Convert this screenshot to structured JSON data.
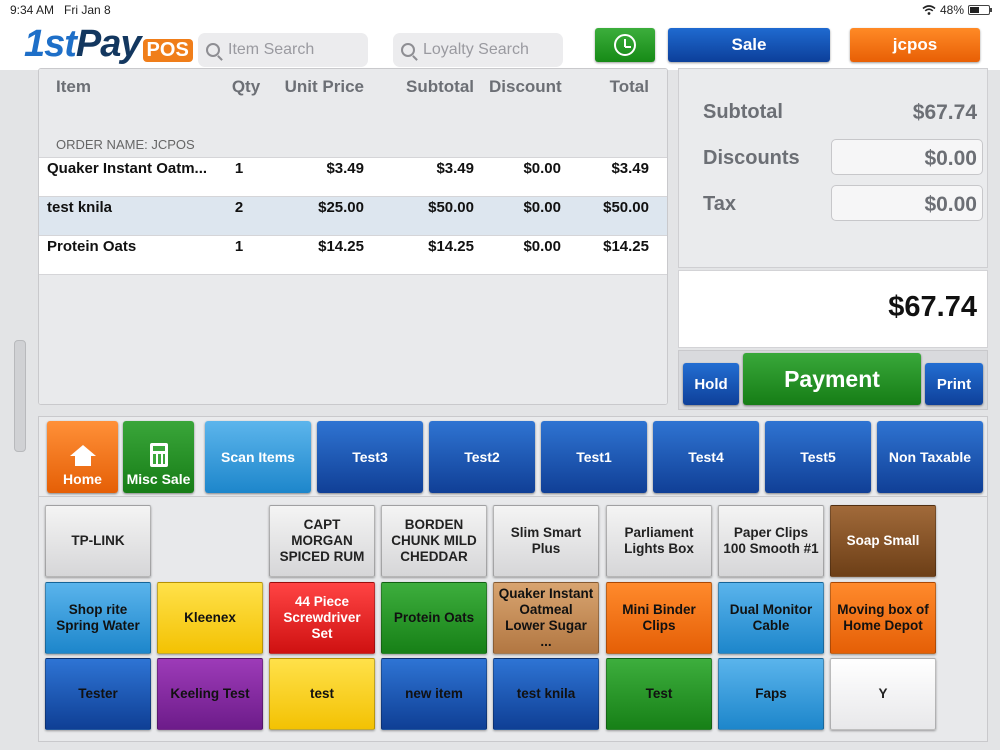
{
  "status": {
    "time": "9:34 AM",
    "date": "Fri Jan 8",
    "battery": "48%",
    "battery_level": 0.48
  },
  "header": {
    "logo_main": "1st",
    "logo_pay": "Pay",
    "logo_pos": "POS",
    "item_search_placeholder": "Item Search",
    "loyalty_search_placeholder": "Loyalty Search",
    "sale_label": "Sale",
    "user_label": "jcpos"
  },
  "order": {
    "headers": {
      "item": "Item",
      "qty": "Qty",
      "unit": "Unit Price",
      "subtotal": "Subtotal",
      "discount": "Discount",
      "total": "Total"
    },
    "order_name": "ORDER NAME: JCPOS",
    "rows": [
      {
        "item": "Quaker Instant Oatm...",
        "qty": "1",
        "unit": "$3.49",
        "subtotal": "$3.49",
        "discount": "$0.00",
        "total": "$3.49"
      },
      {
        "item": "test knila",
        "qty": "2",
        "unit": "$25.00",
        "subtotal": "$50.00",
        "discount": "$0.00",
        "total": "$50.00"
      },
      {
        "item": "Protein Oats",
        "qty": "1",
        "unit": "$14.25",
        "subtotal": "$14.25",
        "discount": "$0.00",
        "total": "$14.25"
      }
    ]
  },
  "totals": {
    "subtotal_label": "Subtotal",
    "subtotal": "$67.74",
    "discounts_label": "Discounts",
    "discounts": "$0.00",
    "tax_label": "Tax",
    "tax": "$0.00",
    "grand_total": "$67.74"
  },
  "actions": {
    "hold": "Hold",
    "payment": "Payment",
    "print": "Print"
  },
  "categories": {
    "home": "Home",
    "misc": "Misc Sale",
    "items": [
      "Scan Items",
      "Test3",
      "Test2",
      "Test1",
      "Test4",
      "Test5",
      "Non Taxable"
    ]
  },
  "tiles": [
    {
      "label": "TP-LINK",
      "color": "gray"
    },
    {
      "label": "CAPT MORGAN SPICED RUM",
      "color": "gray"
    },
    {
      "label": "BORDEN CHUNK MILD CHEDDAR",
      "color": "gray"
    },
    {
      "label": "Slim Smart Plus",
      "color": "gray"
    },
    {
      "label": "Parliament Lights Box",
      "color": "gray"
    },
    {
      "label": "Paper Clips 100 Smooth #1",
      "color": "gray"
    },
    {
      "label": "Soap Small",
      "color": "brown"
    },
    {
      "label": "Shop rite Spring Water",
      "color": "sky"
    },
    {
      "label": "Kleenex",
      "color": "yellow"
    },
    {
      "label": "44 Piece Screwdriver Set",
      "color": "red"
    },
    {
      "label": "Protein Oats",
      "color": "green"
    },
    {
      "label": "Quaker Instant Oatmeal Lower Sugar ...",
      "color": "tan"
    },
    {
      "label": "Mini Binder Clips",
      "color": "orange"
    },
    {
      "label": "Dual Monitor Cable",
      "color": "sky"
    },
    {
      "label": "Moving box of Home Depot",
      "color": "orange"
    },
    {
      "label": "Tester",
      "color": "blue"
    },
    {
      "label": "Keeling Test",
      "color": "purple"
    },
    {
      "label": "test",
      "color": "yellow"
    },
    {
      "label": "new item",
      "color": "blue"
    },
    {
      "label": "test knila",
      "color": "blue"
    },
    {
      "label": "Test",
      "color": "green"
    },
    {
      "label": "Faps",
      "color": "sky"
    },
    {
      "label": "Y",
      "color": "white"
    }
  ]
}
